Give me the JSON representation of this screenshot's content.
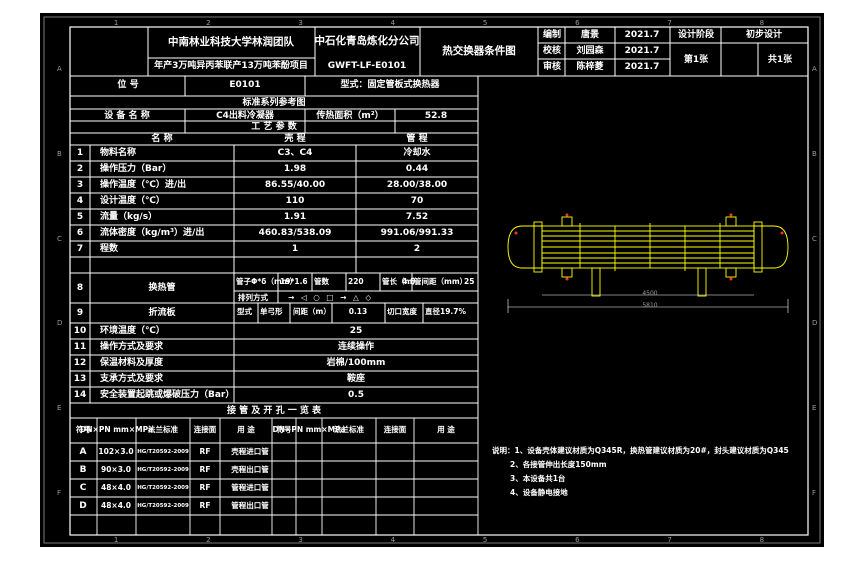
{
  "title_block": {
    "org1": "中南林业科技大学林润团队",
    "org2": "中石化青岛炼化分公司",
    "project": "年产3万吨异丙苯联产13万吨苯酚项目",
    "drawing_no": "GWFT-LF-E0101",
    "drawing_name": "热交换器条件图",
    "roles": [
      {
        "role": "编制",
        "name": "唐景",
        "date": "2021.7"
      },
      {
        "role": "校核",
        "name": "刘园森",
        "date": "2021.7"
      },
      {
        "role": "审核",
        "name": "陈梓菱",
        "date": "2021.7"
      }
    ],
    "stage_label": "设计阶段",
    "stage_value": "初步设计",
    "sheet_no": "第1张",
    "sheet_total": "共1张"
  },
  "position": {
    "label": "位 号",
    "value": "E0101",
    "type_label": "型式：固定管板式换热器"
  },
  "std_ref": "标准系列参考图",
  "equipment": {
    "name_label": "设 备 名 称",
    "name": "C4出料冷凝器",
    "area_label": "传热面积（m²）",
    "area": "52.8"
  },
  "process": {
    "header": "工 艺 参 数",
    "col_item": "名 称",
    "col_shell": "壳 程",
    "col_tube": "管 程",
    "rows": [
      {
        "no": "1",
        "name": "物料名称",
        "shell": "C3、C4",
        "tube": "冷却水"
      },
      {
        "no": "2",
        "name": "操作压力（Bar）",
        "shell": "1.98",
        "tube": "0.44"
      },
      {
        "no": "3",
        "name": "操作温度（℃）进/出",
        "shell": "86.55/40.00",
        "tube": "28.00/38.00"
      },
      {
        "no": "4",
        "name": "设计温度（℃）",
        "shell": "110",
        "tube": "70"
      },
      {
        "no": "5",
        "name": "流量（kg/s）",
        "shell": "1.91",
        "tube": "7.52"
      },
      {
        "no": "6",
        "name": "流体密度（kg/m³）进/出",
        "shell": "460.83/538.09",
        "tube": "991.06/991.33"
      },
      {
        "no": "7",
        "name": "程数",
        "shell": "1",
        "tube": "2"
      }
    ]
  },
  "tubes": {
    "no": "8",
    "name": "换热管",
    "spec": "管子Φ*δ（mm）",
    "spec_val": "19*1.6",
    "count_label": "管数",
    "count_val": "220",
    "len_label": "管长（m）",
    "len_val": "4.5",
    "pitch_label": "管间距（mm）",
    "pitch_val": "25",
    "arr_label": "排列方式",
    "arr_symbols": "→ ◁ ○ □ → △ ◇"
  },
  "baffle": {
    "no": "9",
    "name": "折流板",
    "type_label": "型式",
    "type_val": "单弓形",
    "spacing_label": "间距（m）",
    "spacing_val": "0.13",
    "cut_label": "切口宽度",
    "cut_val": "直径19.7%"
  },
  "process2": [
    {
      "no": "10",
      "name": "环境温度（℃）",
      "value": "25"
    },
    {
      "no": "11",
      "name": "操作方式及要求",
      "value": "连续操作"
    },
    {
      "no": "12",
      "name": "保温材料及厚度",
      "value": "岩棉/100mm"
    },
    {
      "no": "13",
      "name": "支承方式及要求",
      "value": "鞍座"
    },
    {
      "no": "14",
      "name": "安全装置起跳或爆破压力（Bar）",
      "value": "0.5"
    }
  ],
  "nozzles": {
    "header": "接 管 及 开 孔 一 览 表",
    "cols": [
      "符号",
      "DN×PN mm×MPa",
      "法兰标准",
      "连接面",
      "用 途",
      "符号",
      "DN×PN mm×MPa",
      "法兰标准",
      "连接面",
      "用 途"
    ],
    "rows": [
      {
        "sym": "A",
        "dn": "102×3.0",
        "std": "HG/T20592-2009",
        "face": "RF",
        "use": "壳程进口管"
      },
      {
        "sym": "B",
        "dn": "90×3.0",
        "std": "HG/T20592-2009",
        "face": "RF",
        "use": "壳程出口管"
      },
      {
        "sym": "C",
        "dn": "48×4.0",
        "std": "HG/T20592-2009",
        "face": "RF",
        "use": "管程进口管"
      },
      {
        "sym": "D",
        "dn": "48×4.0",
        "std": "HG/T20592-2009",
        "face": "RF",
        "use": "管程出口管"
      }
    ]
  },
  "notes": [
    "说明：1、设备壳体建议材质为Q345R，换热管建议材质为20#，封头建议材质为Q345",
    "2、各接管伸出长度150mm",
    "3、本设备共1台",
    "4、设备静电接地"
  ],
  "zones": {
    "cols": [
      "1",
      "2",
      "3",
      "4",
      "5",
      "6",
      "7",
      "8"
    ],
    "rows": [
      "A",
      "B",
      "C",
      "D",
      "E",
      "F"
    ]
  },
  "drawing": {
    "dim_overall": "5810",
    "dim_tube": "4500"
  },
  "colors": {
    "background": "#000000",
    "lines": "#ffffff",
    "accent": "#ffff00",
    "nozzle_red": "#ff3030",
    "grid": "#9a9a9a"
  }
}
